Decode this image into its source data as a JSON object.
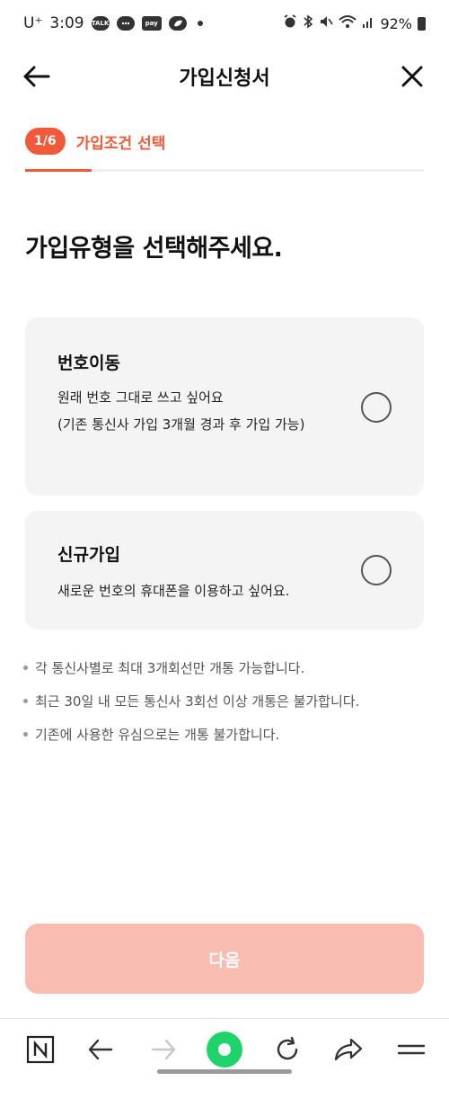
{
  "status_bar": {
    "carrier": "U⁺",
    "time": "3:09",
    "notif_icons": [
      "TALK",
      "chat",
      "pay",
      "leaf"
    ],
    "battery": "92%"
  },
  "header": {
    "title": "가입신청서"
  },
  "step": {
    "badge": "1/6",
    "label": "가입조건 선택",
    "progress": 0.167
  },
  "question": "가입유형을 선택해주세요.",
  "options": [
    {
      "title": "번호이동",
      "desc": "원래 번호 그대로 쓰고 싶어요\n(기존 통신사 가입 3개월 경과 후 가입 가능)",
      "selected": false
    },
    {
      "title": "신규가입",
      "desc": "새로운 번호의 휴대폰을 이용하고 싶어요.",
      "selected": false
    }
  ],
  "notes": [
    "각 통신사별로 최대 3개회선만 개통 가능합니다.",
    "최근 30일 내 모든 통신사 3회선 이상 개통은 불가합니다.",
    "기존에 사용한 유심으로는 개통 불가합니다."
  ],
  "next_button": "다음",
  "colors": {
    "accent": "#f05a3a",
    "button_disabled": "#f8bdb0",
    "card_bg": "#f4f4f4",
    "browser_green": "#1ed46a"
  },
  "browser_bar": {
    "icons": [
      "naver-n-icon",
      "back-arrow-icon",
      "forward-arrow-icon",
      "green-dot-icon",
      "refresh-icon",
      "share-icon",
      "menu-icon"
    ]
  }
}
